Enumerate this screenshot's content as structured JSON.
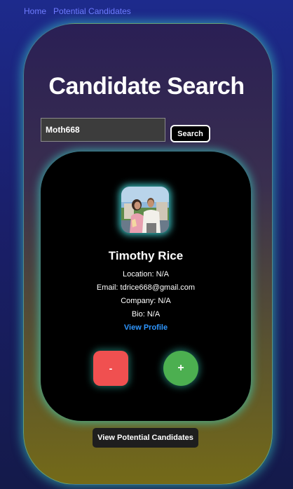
{
  "nav": {
    "home": "Home",
    "potential": "Potential Candidates"
  },
  "title": "Candidate Search",
  "search": {
    "value": "Moth668",
    "button": "Search"
  },
  "candidate": {
    "name": "Timothy Rice",
    "location": "Location: N/A",
    "email": "Email: tdrice668@gmail.com",
    "company": "Company: N/A",
    "bio": "Bio: N/A",
    "profile_link": "View Profile"
  },
  "actions": {
    "reject": "-",
    "accept": "+"
  },
  "footer": {
    "view_button": "View Potential Candidates"
  },
  "colors": {
    "accent_link": "#2e96ff",
    "reject": "#f05050",
    "accept": "#4caf50",
    "glow": "#3cdcc8"
  }
}
